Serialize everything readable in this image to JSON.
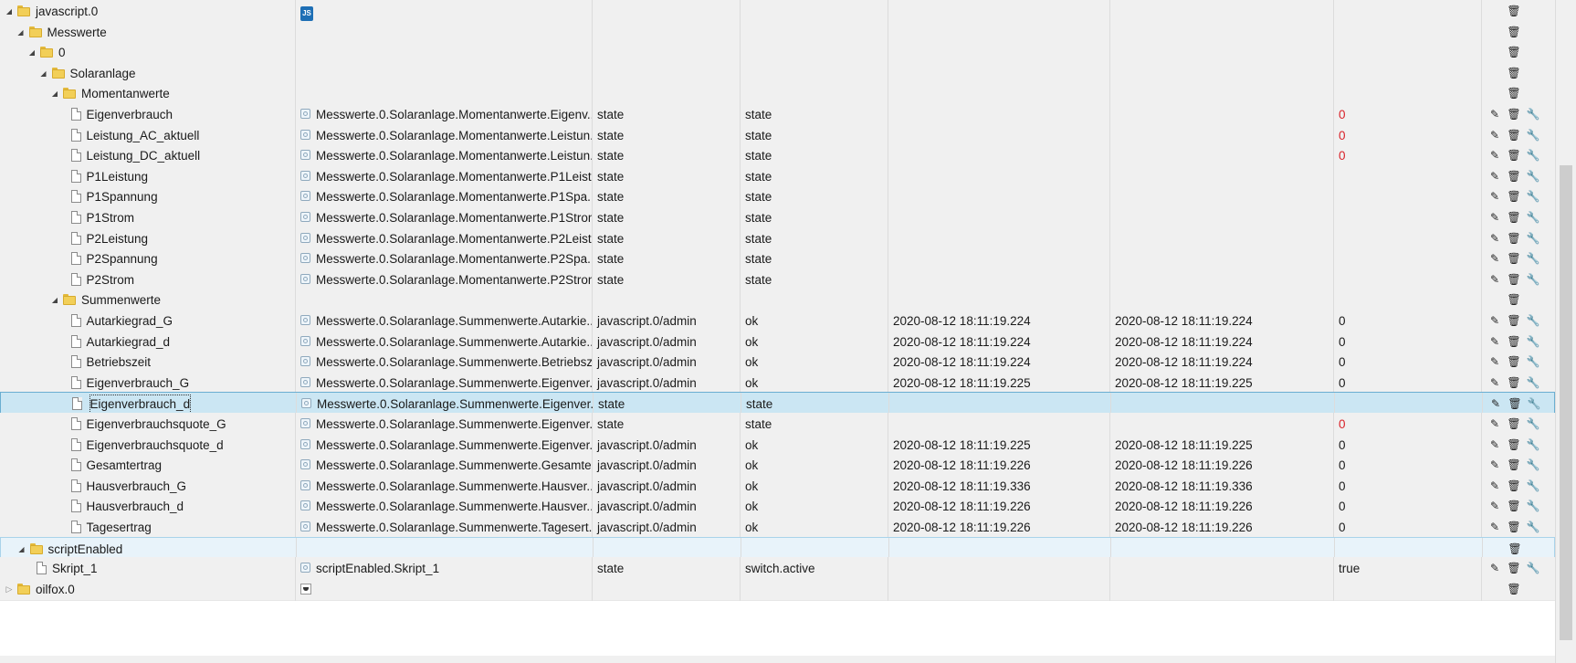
{
  "rows": [
    {
      "name": "javascript.0",
      "type": "folder",
      "depth": 0,
      "toggle": "open",
      "col2": "",
      "col2icon": "js",
      "col3": "",
      "col4": "",
      "col5": "",
      "col6": "",
      "col7": "",
      "actions": "del"
    },
    {
      "name": "Messwerte",
      "type": "folder",
      "depth": 1,
      "toggle": "open",
      "col2": "",
      "col3": "",
      "col4": "",
      "col5": "",
      "col6": "",
      "col7": "",
      "actions": "del"
    },
    {
      "name": "0",
      "type": "folder",
      "depth": 2,
      "toggle": "open",
      "col2": "",
      "col3": "",
      "col4": "",
      "col5": "",
      "col6": "",
      "col7": "",
      "actions": "del"
    },
    {
      "name": "Solaranlage",
      "type": "folder",
      "depth": 3,
      "toggle": "open",
      "col2": "",
      "col3": "",
      "col4": "",
      "col5": "",
      "col6": "",
      "col7": "",
      "actions": "del"
    },
    {
      "name": "Momentanwerte",
      "type": "folder",
      "depth": 4,
      "toggle": "open",
      "col2": "",
      "col3": "",
      "col4": "",
      "col5": "",
      "col6": "",
      "col7": "",
      "actions": "del"
    },
    {
      "name": "Eigenverbrauch",
      "type": "state",
      "depth": 5,
      "col2": "Messwerte.0.Solaranlage.Momentanwerte.Eigenv...",
      "col3": "state",
      "col4": "state",
      "col5": "",
      "col6": "",
      "col7": "0",
      "red": true,
      "actions": "all"
    },
    {
      "name": "Leistung_AC_aktuell",
      "type": "state",
      "depth": 5,
      "col2": "Messwerte.0.Solaranlage.Momentanwerte.Leistun...",
      "col3": "state",
      "col4": "state",
      "col5": "",
      "col6": "",
      "col7": "0",
      "red": true,
      "actions": "all"
    },
    {
      "name": "Leistung_DC_aktuell",
      "type": "state",
      "depth": 5,
      "col2": "Messwerte.0.Solaranlage.Momentanwerte.Leistun...",
      "col3": "state",
      "col4": "state",
      "col5": "",
      "col6": "",
      "col7": "0",
      "red": true,
      "actions": "all"
    },
    {
      "name": "P1Leistung",
      "type": "state",
      "depth": 5,
      "col2": "Messwerte.0.Solaranlage.Momentanwerte.P1Leist...",
      "col3": "state",
      "col4": "state",
      "col5": "",
      "col6": "",
      "col7": "",
      "actions": "all"
    },
    {
      "name": "P1Spannung",
      "type": "state",
      "depth": 5,
      "col2": "Messwerte.0.Solaranlage.Momentanwerte.P1Spa...",
      "col3": "state",
      "col4": "state",
      "col5": "",
      "col6": "",
      "col7": "",
      "actions": "all"
    },
    {
      "name": "P1Strom",
      "type": "state",
      "depth": 5,
      "col2": "Messwerte.0.Solaranlage.Momentanwerte.P1Strom",
      "col3": "state",
      "col4": "state",
      "col5": "",
      "col6": "",
      "col7": "",
      "actions": "all"
    },
    {
      "name": "P2Leistung",
      "type": "state",
      "depth": 5,
      "col2": "Messwerte.0.Solaranlage.Momentanwerte.P2Leist...",
      "col3": "state",
      "col4": "state",
      "col5": "",
      "col6": "",
      "col7": "",
      "actions": "all"
    },
    {
      "name": "P2Spannung",
      "type": "state",
      "depth": 5,
      "col2": "Messwerte.0.Solaranlage.Momentanwerte.P2Spa...",
      "col3": "state",
      "col4": "state",
      "col5": "",
      "col6": "",
      "col7": "",
      "actions": "all"
    },
    {
      "name": "P2Strom",
      "type": "state",
      "depth": 5,
      "col2": "Messwerte.0.Solaranlage.Momentanwerte.P2Strom",
      "col3": "state",
      "col4": "state",
      "col5": "",
      "col6": "",
      "col7": "",
      "actions": "all"
    },
    {
      "name": "Summenwerte",
      "type": "folder",
      "depth": 4,
      "toggle": "open",
      "col2": "",
      "col3": "",
      "col4": "",
      "col5": "",
      "col6": "",
      "col7": "",
      "actions": "del"
    },
    {
      "name": "Autarkiegrad_G",
      "type": "state",
      "depth": 5,
      "col2": "Messwerte.0.Solaranlage.Summenwerte.Autarkie...",
      "col3": "javascript.0/admin",
      "col4": "ok",
      "col5": "2020-08-12 18:11:19.224",
      "col6": "2020-08-12 18:11:19.224",
      "col7": "0",
      "actions": "all"
    },
    {
      "name": "Autarkiegrad_d",
      "type": "state",
      "depth": 5,
      "col2": "Messwerte.0.Solaranlage.Summenwerte.Autarkie...",
      "col3": "javascript.0/admin",
      "col4": "ok",
      "col5": "2020-08-12 18:11:19.224",
      "col6": "2020-08-12 18:11:19.224",
      "col7": "0",
      "actions": "all"
    },
    {
      "name": "Betriebszeit",
      "type": "state",
      "depth": 5,
      "col2": "Messwerte.0.Solaranlage.Summenwerte.Betriebszeit",
      "col3": "javascript.0/admin",
      "col4": "ok",
      "col5": "2020-08-12 18:11:19.224",
      "col6": "2020-08-12 18:11:19.224",
      "col7": "0",
      "actions": "all"
    },
    {
      "name": "Eigenverbrauch_G",
      "type": "state",
      "depth": 5,
      "col2": "Messwerte.0.Solaranlage.Summenwerte.Eigenver...",
      "col3": "javascript.0/admin",
      "col4": "ok",
      "col5": "2020-08-12 18:11:19.225",
      "col6": "2020-08-12 18:11:19.225",
      "col7": "0",
      "actions": "all"
    },
    {
      "name": "Eigenverbrauch_d",
      "type": "state",
      "depth": 5,
      "selected": true,
      "col2": "Messwerte.0.Solaranlage.Summenwerte.Eigenver...",
      "col3": "state",
      "col4": "state",
      "col5": "",
      "col6": "",
      "col7": "",
      "actions": "all"
    },
    {
      "name": "Eigenverbrauchsquote_G",
      "type": "state",
      "depth": 5,
      "col2": "Messwerte.0.Solaranlage.Summenwerte.Eigenver...",
      "col3": "state",
      "col4": "state",
      "col5": "",
      "col6": "",
      "col7": "0",
      "red": true,
      "actions": "all"
    },
    {
      "name": "Eigenverbrauchsquote_d",
      "type": "state",
      "depth": 5,
      "col2": "Messwerte.0.Solaranlage.Summenwerte.Eigenver...",
      "col3": "javascript.0/admin",
      "col4": "ok",
      "col5": "2020-08-12 18:11:19.225",
      "col6": "2020-08-12 18:11:19.225",
      "col7": "0",
      "actions": "all"
    },
    {
      "name": "Gesamtertrag",
      "type": "state",
      "depth": 5,
      "col2": "Messwerte.0.Solaranlage.Summenwerte.Gesamte...",
      "col3": "javascript.0/admin",
      "col4": "ok",
      "col5": "2020-08-12 18:11:19.226",
      "col6": "2020-08-12 18:11:19.226",
      "col7": "0",
      "actions": "all"
    },
    {
      "name": "Hausverbrauch_G",
      "type": "state",
      "depth": 5,
      "col2": "Messwerte.0.Solaranlage.Summenwerte.Hausver...",
      "col3": "javascript.0/admin",
      "col4": "ok",
      "col5": "2020-08-12 18:11:19.336",
      "col6": "2020-08-12 18:11:19.336",
      "col7": "0",
      "actions": "all"
    },
    {
      "name": "Hausverbrauch_d",
      "type": "state",
      "depth": 5,
      "col2": "Messwerte.0.Solaranlage.Summenwerte.Hausver...",
      "col3": "javascript.0/admin",
      "col4": "ok",
      "col5": "2020-08-12 18:11:19.226",
      "col6": "2020-08-12 18:11:19.226",
      "col7": "0",
      "actions": "all"
    },
    {
      "name": "Tagesertrag",
      "type": "state",
      "depth": 5,
      "col2": "Messwerte.0.Solaranlage.Summenwerte.Tagesert...",
      "col3": "javascript.0/admin",
      "col4": "ok",
      "col5": "2020-08-12 18:11:19.226",
      "col6": "2020-08-12 18:11:19.226",
      "col7": "0",
      "actions": "all"
    },
    {
      "name": "scriptEnabled",
      "type": "folder",
      "depth": 1,
      "toggle": "open",
      "highlight": true,
      "col2": "",
      "col3": "",
      "col4": "",
      "col5": "",
      "col6": "",
      "col7": "",
      "actions": "del"
    },
    {
      "name": "Skript_1",
      "type": "state",
      "depth": 2,
      "col2": "scriptEnabled.Skript_1",
      "col3": "state",
      "col4": "switch.active",
      "col5": "",
      "col6": "",
      "col7": "true",
      "actions": "all"
    },
    {
      "name": "oilfox.0",
      "type": "folder",
      "depth": 0,
      "toggle": "closed",
      "col2": "",
      "col2icon": "oil",
      "col3": "",
      "col4": "",
      "col5": "",
      "col6": "",
      "col7": "",
      "actions": "del"
    }
  ],
  "icons": {
    "edit": "pencil-icon",
    "delete": "trash-icon",
    "settings": "wrench-icon",
    "folder": "folder-icon",
    "file": "file-icon",
    "state": "state-icon"
  },
  "colors": {
    "zero_red": "#d9232a",
    "selection": "#cbe6f3",
    "folder": "#f2cf58"
  }
}
